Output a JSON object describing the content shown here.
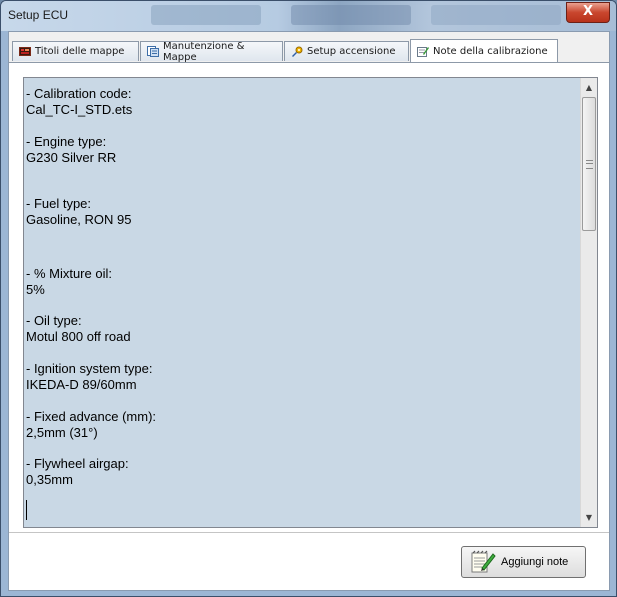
{
  "window": {
    "title": "Setup ECU",
    "close_label": "X"
  },
  "tabs": [
    {
      "label": "Titoli delle mappe",
      "icon": "map-titles-icon"
    },
    {
      "label": "Manutenzione & Mappe",
      "icon": "maintenance-maps-icon"
    },
    {
      "label": "Setup accensione",
      "icon": "ignition-setup-icon"
    },
    {
      "label": "Note della calibrazione",
      "icon": "notes-icon",
      "active": true
    }
  ],
  "notes": [
    {
      "label": "- Calibration code:",
      "value": "Cal_TC-I_STD.ets"
    },
    {
      "label": " - Engine type:",
      "value": "G230 Silver RR"
    },
    {
      "label": "- Fuel type:",
      "value": "Gasoline, RON 95"
    },
    {
      "label": " - % Mixture oil:",
      "value": "5%"
    },
    {
      "label": "- Oil type:",
      "value": "Motul 800 off road"
    },
    {
      "label": " - Ignition system type:",
      "value": "IKEDA-D 89/60mm"
    },
    {
      "label": " - Fixed advance (mm):",
      "value": "2,5mm (31°)"
    },
    {
      "label": " - Flywheel airgap:",
      "value": "0,35mm"
    }
  ],
  "footer": {
    "add_notes_label": "Aggiungi note"
  },
  "colors": {
    "text_area_bg": "#c9d8e5",
    "close_button": "#c9462e",
    "window_frame": "#9cb6d4"
  }
}
